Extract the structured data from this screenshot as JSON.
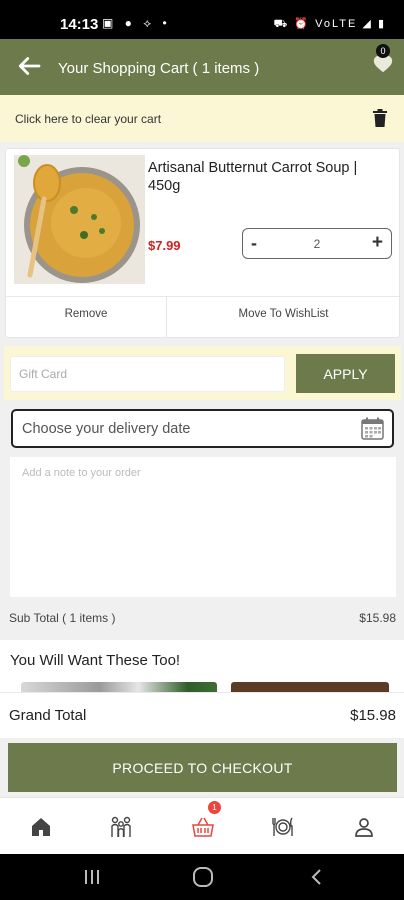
{
  "status_bar": {
    "time": "14:13",
    "left_icons": "▣ ● ⟡ •",
    "right_icons": "⛟ ⏰ VoLTE ◢ ▮"
  },
  "header": {
    "title": "Your Shopping Cart ( 1 items )",
    "wishlist_count": "0"
  },
  "clear_cart": {
    "label": "Click here to clear your cart"
  },
  "cart_items": [
    {
      "name": "Artisanal Butternut Carrot Soup | 450g",
      "price": "$7.99",
      "quantity": "2",
      "minus": "-",
      "plus": "+",
      "remove_label": "Remove",
      "wishlist_label": "Move To WishList"
    }
  ],
  "gift_card": {
    "placeholder": "Gift Card",
    "apply_label": "APPLY"
  },
  "delivery_date": {
    "placeholder": "Choose your delivery date"
  },
  "order_note": {
    "placeholder": "Add a note to your order"
  },
  "sub_total": {
    "label": "Sub Total ( 1 items )",
    "value": "$15.98"
  },
  "recommendations": {
    "title": "You Will Want These Too!"
  },
  "grand_total": {
    "label": "Grand Total",
    "value": "$15.98"
  },
  "checkout": {
    "label": "PROCEED TO CHECKOUT"
  },
  "bottom_nav": {
    "cart_badge": "1",
    "active_color": "#e8463f",
    "icons": [
      "home-icon",
      "family-icon",
      "basket-icon",
      "plate-icon",
      "user-icon"
    ]
  },
  "colors": {
    "brand_green": "#6d7a4b",
    "banner_yellow": "#fbf6d4",
    "price_red": "#d32020"
  }
}
